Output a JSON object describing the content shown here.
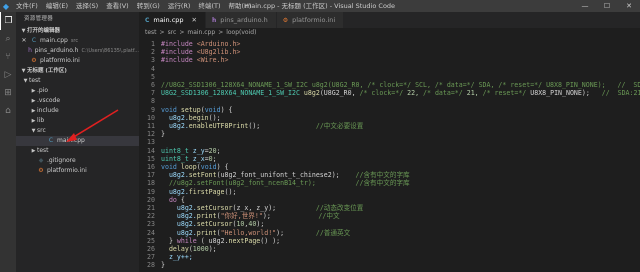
{
  "window": {
    "title": "main.cpp - 无标题 (工作区) - Visual Studio Code",
    "controls": [
      "—",
      "☐",
      "✕"
    ]
  },
  "menu": [
    "文件(F)",
    "编辑(E)",
    "选择(S)",
    "查看(V)",
    "转到(G)",
    "运行(R)",
    "终端(T)",
    "帮助(H)"
  ],
  "sidebar": {
    "title": "资源管理器",
    "open_editors_label": "打开的编辑器",
    "open_editors": [
      {
        "name": "main.cpp",
        "suffix": "src",
        "icon": "cpp-file-icon",
        "close": "✕"
      },
      {
        "name": "pins_arduino.h",
        "suffix": "C:\\Users\\86135\\.platf...",
        "icon": "h-file-icon"
      },
      {
        "name": "platformio.ini",
        "suffix": "",
        "icon": "ini-file-icon"
      }
    ],
    "workspace_label": "无标题 (工作区)",
    "tree": [
      {
        "name": "test",
        "kind": "folder-open"
      },
      {
        "name": ".pio",
        "kind": "folder"
      },
      {
        "name": ".vscode",
        "kind": "folder"
      },
      {
        "name": "include",
        "kind": "folder"
      },
      {
        "name": "lib",
        "kind": "folder"
      },
      {
        "name": "src",
        "kind": "folder-open"
      },
      {
        "name": "main.cpp",
        "kind": "file-cpp"
      },
      {
        "name": "test",
        "kind": "folder"
      },
      {
        "name": ".gitignore",
        "kind": "file"
      },
      {
        "name": "platformio.ini",
        "kind": "file-ini"
      }
    ]
  },
  "tabs": [
    {
      "label": "main.cpp",
      "icon": "C",
      "active": true,
      "close": "✕"
    },
    {
      "label": "pins_arduino.h",
      "icon": "h",
      "active": false
    },
    {
      "label": "platformio.ini",
      "icon": "⚙",
      "active": false
    }
  ],
  "breadcrumb": [
    "test",
    ">",
    "src",
    ">",
    "main.cpp",
    ">",
    "loop(void)"
  ],
  "colors": {
    "keyword": "#569cd6",
    "preproc": "#c586c0",
    "string": "#ce9178",
    "comment": "#6a9955",
    "function": "#dcdcaa",
    "number": "#b5cea8",
    "variable": "#9cdcfe",
    "type": "#4ec9b0",
    "default": "#d4d4d4"
  },
  "code_lines": [
    [
      {
        "t": "#include ",
        "c": "preproc"
      },
      {
        "t": "<Arduino.h>",
        "c": "string"
      }
    ],
    [
      {
        "t": "#include ",
        "c": "preproc"
      },
      {
        "t": "<U8g2lib.h>",
        "c": "string"
      }
    ],
    [
      {
        "t": "#include ",
        "c": "preproc"
      },
      {
        "t": "<Wire.h>",
        "c": "string"
      }
    ],
    [],
    [],
    [
      {
        "t": "//U8G2_SSD1306_128X64_NONAME_1_SW_I2C u8g2(U8G2_R0, /* clock=*/ SCL, /* data=*/ SDA, /* reset=*/ U8X8_PIN_NONE);   //  SDA:21 scl:22",
        "c": "comment"
      }
    ],
    [
      {
        "t": "U8G2_SSD1306_128X64_NONAME_1_SW_I2C ",
        "c": "type"
      },
      {
        "t": "u8g2",
        "c": "function"
      },
      {
        "t": "(U8G2_R0, ",
        "c": "default"
      },
      {
        "t": "/* clock=*/",
        "c": "comment"
      },
      {
        "t": " 22, ",
        "c": "number"
      },
      {
        "t": "/* data=*/",
        "c": "comment"
      },
      {
        "t": " 21, ",
        "c": "number"
      },
      {
        "t": "/* reset=*/",
        "c": "comment"
      },
      {
        "t": " U8X8_PIN_NONE);   ",
        "c": "default"
      },
      {
        "t": "//  SDA:21 scl:22",
        "c": "comment"
      }
    ],
    [],
    [
      {
        "t": "void ",
        "c": "keyword"
      },
      {
        "t": "setup",
        "c": "function"
      },
      {
        "t": "(",
        "c": "default"
      },
      {
        "t": "void",
        "c": "keyword"
      },
      {
        "t": ") {",
        "c": "default"
      }
    ],
    [
      {
        "t": "  u8g2.",
        "c": "variable"
      },
      {
        "t": "begin",
        "c": "function"
      },
      {
        "t": "();",
        "c": "default"
      }
    ],
    [
      {
        "t": "  u8g2.",
        "c": "variable"
      },
      {
        "t": "enableUTF8Print",
        "c": "function"
      },
      {
        "t": "();              ",
        "c": "default"
      },
      {
        "t": "//中文必要设置",
        "c": "comment"
      }
    ],
    [
      {
        "t": "}",
        "c": "default"
      }
    ],
    [],
    [
      {
        "t": "uint8_t ",
        "c": "type"
      },
      {
        "t": "z_y",
        "c": "variable"
      },
      {
        "t": "=",
        "c": "default"
      },
      {
        "t": "20",
        "c": "number"
      },
      {
        "t": ";",
        "c": "default"
      }
    ],
    [
      {
        "t": "uint8_t ",
        "c": "type"
      },
      {
        "t": "z_x",
        "c": "variable"
      },
      {
        "t": "=",
        "c": "default"
      },
      {
        "t": "0",
        "c": "number"
      },
      {
        "t": ";",
        "c": "default"
      }
    ],
    [
      {
        "t": "void ",
        "c": "keyword"
      },
      {
        "t": "loop",
        "c": "function"
      },
      {
        "t": "(",
        "c": "default"
      },
      {
        "t": "void",
        "c": "keyword"
      },
      {
        "t": ") {",
        "c": "default"
      }
    ],
    [
      {
        "t": "  u8g2.",
        "c": "variable"
      },
      {
        "t": "setFont",
        "c": "function"
      },
      {
        "t": "(u8g2_font_unifont_t_chinese2);    ",
        "c": "default"
      },
      {
        "t": "//含有中文的字库",
        "c": "comment"
      }
    ],
    [
      {
        "t": "  //u8g2.setFont(u8g2_font_ncenB14_tr);          //含有中文的字库",
        "c": "comment"
      }
    ],
    [
      {
        "t": "  u8g2.",
        "c": "variable"
      },
      {
        "t": "firstPage",
        "c": "function"
      },
      {
        "t": "();",
        "c": "default"
      }
    ],
    [
      {
        "t": "  ",
        "c": "default"
      },
      {
        "t": "do",
        "c": "preproc"
      },
      {
        "t": " {",
        "c": "default"
      }
    ],
    [
      {
        "t": "    u8g2.",
        "c": "variable"
      },
      {
        "t": "setCursor",
        "c": "function"
      },
      {
        "t": "(z_x, z_y);          ",
        "c": "default"
      },
      {
        "t": "//动态改变位置",
        "c": "comment"
      }
    ],
    [
      {
        "t": "    u8g2.",
        "c": "variable"
      },
      {
        "t": "print",
        "c": "function"
      },
      {
        "t": "(",
        "c": "default"
      },
      {
        "t": "\"你好,世界!\"",
        "c": "string"
      },
      {
        "t": ");            ",
        "c": "default"
      },
      {
        "t": "//中文",
        "c": "comment"
      }
    ],
    [
      {
        "t": "    u8g2.",
        "c": "variable"
      },
      {
        "t": "setCursor",
        "c": "function"
      },
      {
        "t": "(",
        "c": "default"
      },
      {
        "t": "10",
        "c": "number"
      },
      {
        "t": ",",
        "c": "default"
      },
      {
        "t": "40",
        "c": "number"
      },
      {
        "t": ");",
        "c": "default"
      }
    ],
    [
      {
        "t": "    u8g2.",
        "c": "variable"
      },
      {
        "t": "print",
        "c": "function"
      },
      {
        "t": "(",
        "c": "default"
      },
      {
        "t": "\"Hello,world!\"",
        "c": "string"
      },
      {
        "t": ");        ",
        "c": "default"
      },
      {
        "t": "//普通英文",
        "c": "comment"
      }
    ],
    [
      {
        "t": "  } ",
        "c": "default"
      },
      {
        "t": "while",
        "c": "preproc"
      },
      {
        "t": " ( u8g2.",
        "c": "default"
      },
      {
        "t": "nextPage",
        "c": "function"
      },
      {
        "t": "() );",
        "c": "default"
      }
    ],
    [
      {
        "t": "  ",
        "c": "default"
      },
      {
        "t": "delay",
        "c": "function"
      },
      {
        "t": "(",
        "c": "default"
      },
      {
        "t": "1000",
        "c": "number"
      },
      {
        "t": ");",
        "c": "default"
      }
    ],
    [
      {
        "t": "  z_y++;",
        "c": "variable"
      }
    ],
    [
      {
        "t": "}",
        "c": "default"
      }
    ]
  ]
}
